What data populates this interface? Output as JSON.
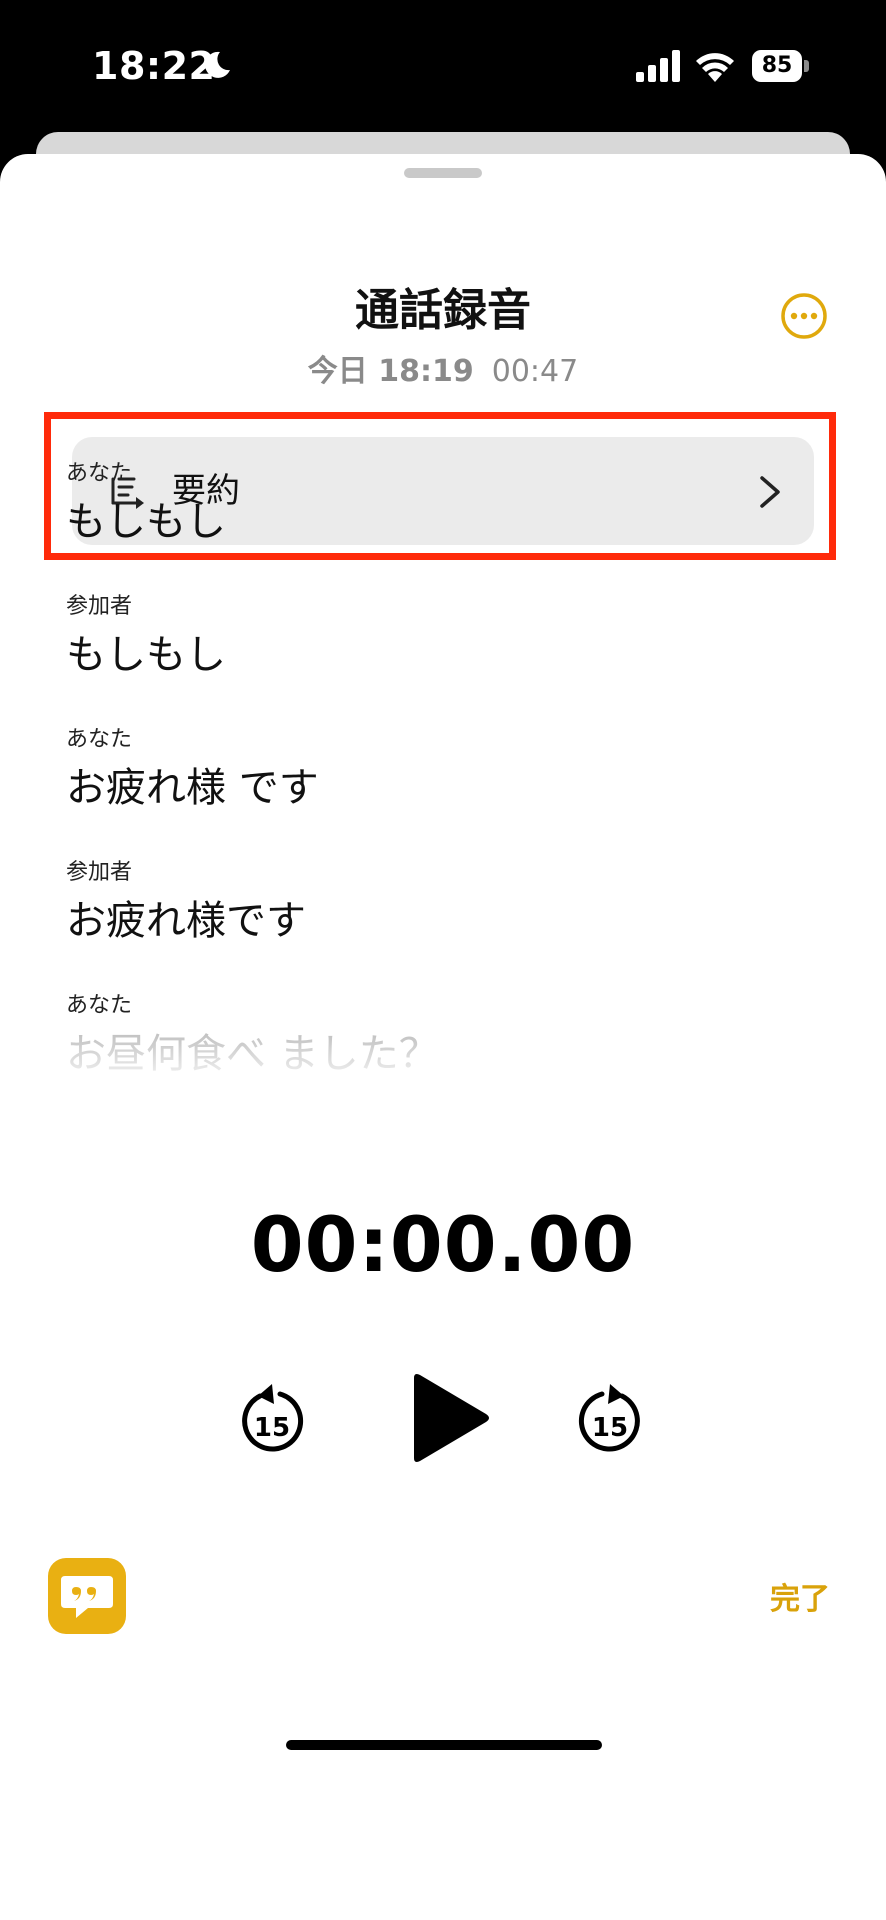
{
  "status_bar": {
    "time": "18:22",
    "battery": "85",
    "icons": [
      "moon-icon",
      "signal-icon",
      "wifi-icon",
      "battery-icon"
    ]
  },
  "header": {
    "title": "通話録音",
    "date": "今日 18:19",
    "duration": "00:47",
    "more_icon": "ellipsis-circle-icon"
  },
  "summary": {
    "label": "要約",
    "icon": "summary-list-icon",
    "chevron_icon": "chevron-right-icon"
  },
  "transcript": [
    {
      "speaker": "あなた",
      "text": "もしもし"
    },
    {
      "speaker": "参加者",
      "text": "もしもし"
    },
    {
      "speaker": "あなた",
      "text": "お疲れ様 です"
    },
    {
      "speaker": "参加者",
      "text": "お疲れ様です"
    },
    {
      "speaker": "あなた",
      "text": "お昼何食べ ました？"
    }
  ],
  "player": {
    "time": "00:00.00",
    "skip_back": "15",
    "skip_forward": "15"
  },
  "footer": {
    "done_label": "完了",
    "transcript_icon": "quote-bubble-icon"
  },
  "colors": {
    "accent": "#e9b012",
    "highlight": "#ff2a0a"
  }
}
